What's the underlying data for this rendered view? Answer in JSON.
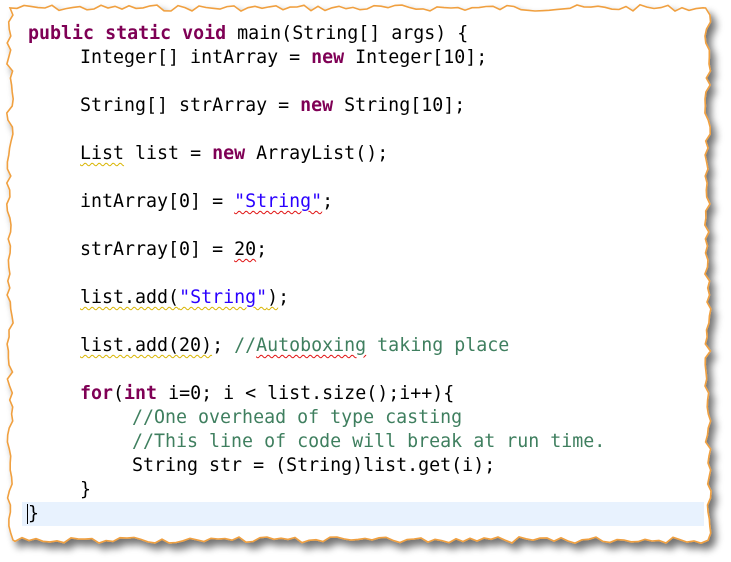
{
  "code": {
    "l1": {
      "k1": "public",
      "k2": "static",
      "k3": "void",
      "rest": " main(String[] args) {"
    },
    "l2": {
      "a": "Integer[] intArray = ",
      "k": "new",
      "b": " Integer[10];"
    },
    "l3": {
      "a": "String[] strArray = ",
      "k": "new",
      "b": " String[10];"
    },
    "l4": {
      "sq": "List",
      "a": " list = ",
      "k": "new",
      "b": " ArrayList",
      "c": "();"
    },
    "l5": {
      "a": "intArray[0] = ",
      "s": "\"String\"",
      "b": ";"
    },
    "l6": {
      "a": "strArray[0] = ",
      "n": "20",
      "b": ";"
    },
    "l7": {
      "a": "list.add(",
      "s": "\"String\"",
      "b": ");"
    },
    "l8": {
      "a": "list.add(20)",
      "b": "; ",
      "c1": "//",
      "c2": "Autoboxing",
      "c3": " taking place"
    },
    "l9": {
      "k1": "for",
      "a": "(",
      "k2": "int",
      "b": " i=0; i < list.size();i++){"
    },
    "l10": {
      "c": "//One overhead of type casting"
    },
    "l11": {
      "c": "//This line of code will break at run time."
    },
    "l12": {
      "a": "String str = (String)list.get(i);"
    },
    "l13": {
      "a": "}"
    },
    "l14": {
      "a": "}"
    }
  },
  "colors": {
    "keyword": "#7f0055",
    "string": "#2a00ff",
    "comment": "#3f7f5f",
    "frame_border": "#f0a040",
    "current_line": "#e8f2fe"
  }
}
